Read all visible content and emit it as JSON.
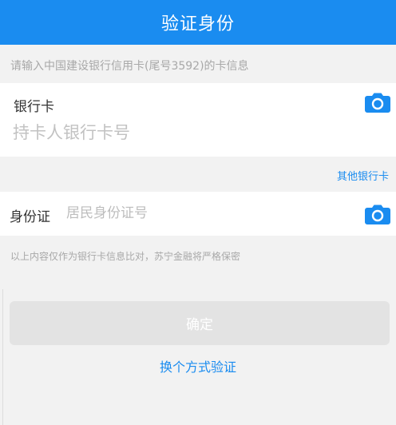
{
  "header": {
    "title": "验证身份"
  },
  "hint": "请输入中国建设银行信用卡(尾号3592)的卡信息",
  "bank_card": {
    "label": "银行卡",
    "placeholder": "持卡人银行卡号",
    "camera_icon": "camera-icon"
  },
  "other_card_link": "其他银行卡",
  "id_card": {
    "label": "身份证",
    "placeholder": "居民身份证号",
    "camera_icon": "camera-icon"
  },
  "notice": "以上内容仅作为银行卡信息比对，苏宁金融将严格保密",
  "confirm_button": "确定",
  "switch_link": "换个方式验证",
  "colors": {
    "accent": "#1a8cf0",
    "background": "#f2f2f2",
    "disabled_button": "#e3e3e3"
  }
}
